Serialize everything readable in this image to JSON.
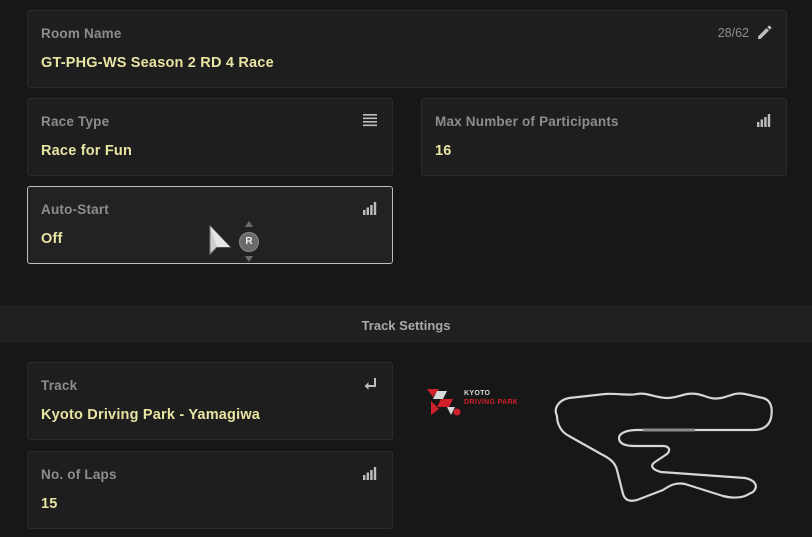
{
  "room_name": {
    "label": "Room Name",
    "value": "GT-PHG-WS Season 2 RD 4 Race",
    "counter": "28/62",
    "icon": "pencil-icon"
  },
  "race_type": {
    "label": "Race Type",
    "value": "Race for Fun",
    "icon": "list-icon"
  },
  "max_participants": {
    "label": "Max Number of Participants",
    "value": "16",
    "icon": "signal-bars-icon"
  },
  "auto_start": {
    "label": "Auto-Start",
    "value": "Off",
    "icon": "signal-bars-icon",
    "focused": true
  },
  "controller_hint": {
    "button": "R"
  },
  "track_settings": {
    "title": "Track Settings"
  },
  "track": {
    "label": "Track",
    "value": "Kyoto Driving Park - Yamagiwa",
    "icon": "enter-return-icon",
    "logo_line1": "KYOTO",
    "logo_line2": "DRIVING PARK"
  },
  "laps": {
    "label": "No. of Laps",
    "value": "15",
    "icon": "signal-bars-icon"
  },
  "colors": {
    "background": "#171717",
    "panel": "#1e1e1e",
    "label": "#8d8d8d",
    "value": "#e8e4a3",
    "focus_border": "#bdbdbd",
    "brand_red": "#d0202a"
  }
}
